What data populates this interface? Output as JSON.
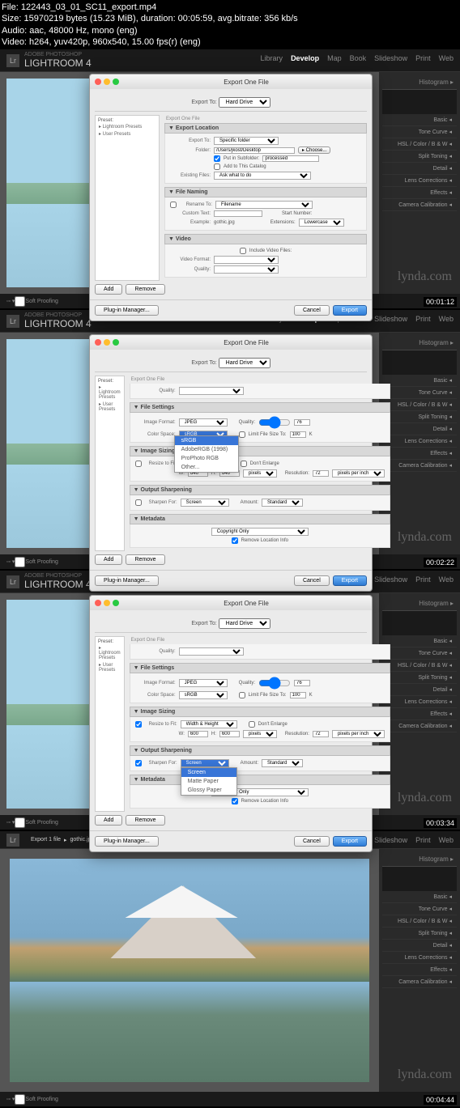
{
  "file_info": {
    "file": "File: 122443_03_01_SC11_export.mp4",
    "size": "Size: 15970219 bytes (15.23 MiB), duration: 00:05:59, avg.bitrate: 356 kb/s",
    "audio": "Audio: aac, 48000 Hz, mono (eng)",
    "video": "Video: h264, yuv420p, 960x540, 15.00 fps(r) (eng)"
  },
  "app": {
    "vendor": "ADOBE PHOTOSHOP",
    "name": "LIGHTROOM 4"
  },
  "nav": {
    "library": "Library",
    "develop": "Develop",
    "map": "Map",
    "book": "Book",
    "slideshow": "Slideshow",
    "print": "Print",
    "web": "Web"
  },
  "panel": {
    "histogram": "Histogram ▸",
    "basic": "Basic ◂",
    "tone_curve": "Tone Curve ◂",
    "hsl": "HSL / Color / B & W ◂",
    "split_toning": "Split Toning ◂",
    "detail": "Detail ◂",
    "lens": "Lens Corrections ◂",
    "effects": "Effects ◂",
    "camera": "Camera Calibration ◂"
  },
  "dialog": {
    "title": "Export One File",
    "export_to_label": "Export To:",
    "export_to_value": "Hard Drive",
    "preset_header": "Preset:",
    "preset1": "▸ Lightroom Presets",
    "preset2": "▸ User Presets",
    "add": "Add",
    "remove": "Remove",
    "plugin": "Plug-in Manager...",
    "cancel": "Cancel",
    "export": "Export"
  },
  "f1": {
    "sec_location": "▼ Export Location",
    "export_to": "Export To:",
    "specific_folder": "Specific folder",
    "folder": "Folder:",
    "folder_val": "/Users/jkost/Desktop",
    "choose": "▸ Choose...",
    "put_sub": "Put in Subfolder:",
    "sub_val": "processed",
    "add_catalog": "Add to This Catalog",
    "existing": "Existing Files:",
    "existing_val": "Ask what to do",
    "sec_naming": "▼ File Naming",
    "rename": "Rename To:",
    "filename": "Filename",
    "custom": "Custom Text:",
    "start_num": "Start Number:",
    "example": "Example:",
    "example_val": "gothic.jpg",
    "extensions": "Extensions:",
    "ext_val": "Lowercase",
    "sec_video": "▼ Video",
    "inc_video": "Include Video Files:",
    "vformat": "Video Format:",
    "quality": "Quality:",
    "ts": "00:01:12"
  },
  "f2": {
    "quality": "Quality:",
    "sec_file": "▼ File Settings",
    "img_format": "Image Format:",
    "jpeg": "JPEG",
    "quality_val": "76",
    "color_space": "Color Space:",
    "limit_size": "Limit File Size To:",
    "size_val": "100",
    "k": "K",
    "dd_srgb": "sRGB",
    "dd_adobe": "AdobeRGB (1998)",
    "dd_prophoto": "ProPhoto RGB",
    "dd_other": "Other...",
    "sec_sizing": "▼ Image Sizing",
    "resize": "Resize to Fit:",
    "w": "W:",
    "wval": "640",
    "h": "H:",
    "hval": "640",
    "pixels": "pixels",
    "dont_enlarge": "Don't Enlarge",
    "resolution": "Resolution:",
    "res_val": "72",
    "ppi": "pixels per inch",
    "sec_sharp": "▼ Output Sharpening",
    "sharpen_for": "Sharpen For:",
    "screen": "Screen",
    "amount": "Amount:",
    "standard": "Standard",
    "sec_meta": "▼ Metadata",
    "copyright": "Copyright Only",
    "remove_loc": "Remove Location Info",
    "ts": "00:02:22"
  },
  "f3": {
    "srgb": "sRGB",
    "width_height": "Width & Height",
    "wval": "600",
    "hval": "600",
    "dd_screen": "Screen",
    "dd_matte": "Matte Paper",
    "dd_glossy": "Glossy Paper",
    "ts": "00:03:34"
  },
  "f4": {
    "bc1": "Export 1 file",
    "bc2": "gothic.jpg",
    "ts": "00:04:44"
  },
  "bottom": {
    "soft_proof": "Soft Proofing"
  },
  "watermark": "lynda.com"
}
